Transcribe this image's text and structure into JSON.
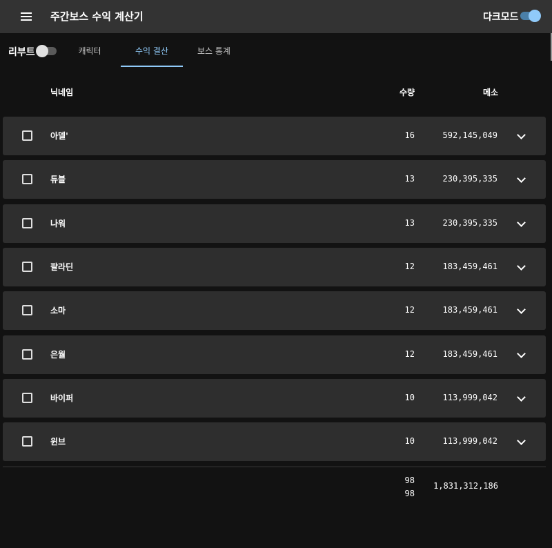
{
  "appbar": {
    "title": "주간보스 수익 계산기",
    "menu_icon": "menu-icon",
    "dark_mode_label": "다크모드",
    "dark_mode_on": true
  },
  "toolbar": {
    "reboot_label": "리부트",
    "reboot_on": false,
    "tabs": [
      {
        "label": "캐릭터",
        "active": false
      },
      {
        "label": "수익 결산",
        "active": true
      },
      {
        "label": "보스 통계",
        "active": false
      }
    ]
  },
  "table": {
    "headers": {
      "nickname": "닉네임",
      "quantity": "수량",
      "meso": "메소"
    },
    "rows": [
      {
        "nickname": "아델'",
        "quantity": "16",
        "meso": "592,145,049"
      },
      {
        "nickname": "듀블",
        "quantity": "13",
        "meso": "230,395,335"
      },
      {
        "nickname": "나워",
        "quantity": "13",
        "meso": "230,395,335"
      },
      {
        "nickname": "팔라딘",
        "quantity": "12",
        "meso": "183,459,461"
      },
      {
        "nickname": "소마",
        "quantity": "12",
        "meso": "183,459,461"
      },
      {
        "nickname": "은월",
        "quantity": "12",
        "meso": "183,459,461"
      },
      {
        "nickname": "바이퍼",
        "quantity": "10",
        "meso": "113,999,042"
      },
      {
        "nickname": "윈브",
        "quantity": "10",
        "meso": "113,999,042"
      }
    ],
    "totals": {
      "quantity_top": "98",
      "quantity_bottom": "98",
      "meso": "1,831,312,186"
    }
  },
  "colors": {
    "accent": "#90caf9",
    "appbar_bg": "#333333",
    "page_bg": "#121212",
    "row_bg": "#2e2e2e"
  }
}
